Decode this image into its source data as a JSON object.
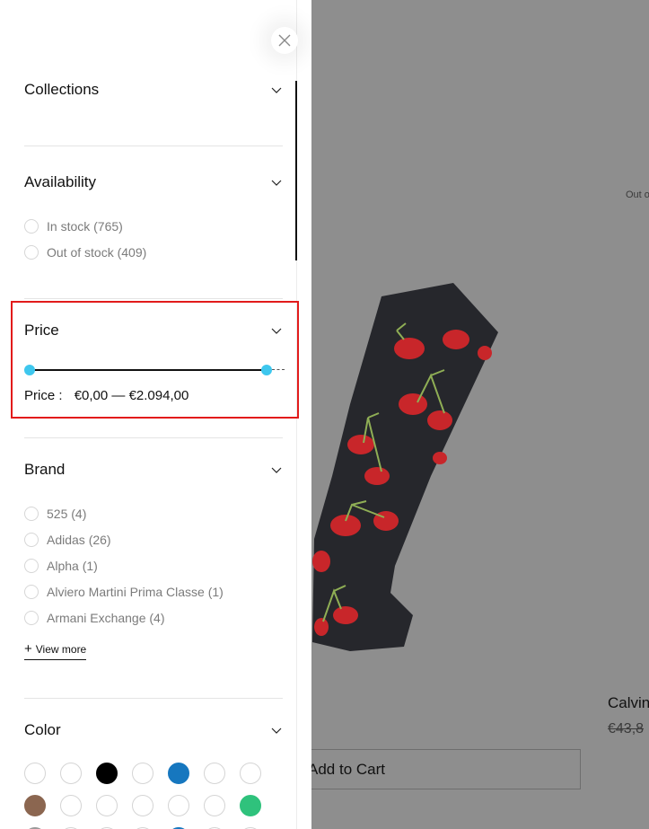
{
  "background": {
    "out_of_stock_text": "Out o",
    "product_title": "Calvin",
    "product_price": "€43,8",
    "add_to_cart": "Add to Cart"
  },
  "filter_drawer": {
    "close_icon": "close-icon",
    "sections": {
      "collections": {
        "title": "Collections"
      },
      "availability": {
        "title": "Availability",
        "options": [
          {
            "label": "In stock (765)"
          },
          {
            "label": "Out of stock (409)"
          }
        ]
      },
      "price": {
        "title": "Price",
        "label": "Price :",
        "min": "€0,00",
        "separator": "—",
        "max": "€2.094,00"
      },
      "brand": {
        "title": "Brand",
        "options": [
          {
            "label": "525 (4)"
          },
          {
            "label": "Adidas (26)"
          },
          {
            "label": "Alpha (1)"
          },
          {
            "label": "Alviero Martini Prima Classe (1)"
          },
          {
            "label": "Armani Exchange (4)"
          }
        ],
        "view_more": "View more"
      },
      "color": {
        "title": "Color",
        "swatches": [
          "#ffffff",
          "#ffffff",
          "#000000",
          "#ffffff",
          "#1677bf",
          "#ffffff",
          "#ffffff",
          "#8b6650",
          "#ffffff",
          "#ffffff",
          "#ffffff",
          "#ffffff",
          "#ffffff",
          "#2fc27c",
          "#9a9a9a",
          "#ffffff",
          "#ffffff",
          "#ffffff",
          "#1677bf",
          "#ffffff",
          "#ffffff"
        ]
      }
    },
    "colors": {
      "highlight_border": "#e21b1b",
      "slider_handle": "#3ec7ee"
    }
  }
}
